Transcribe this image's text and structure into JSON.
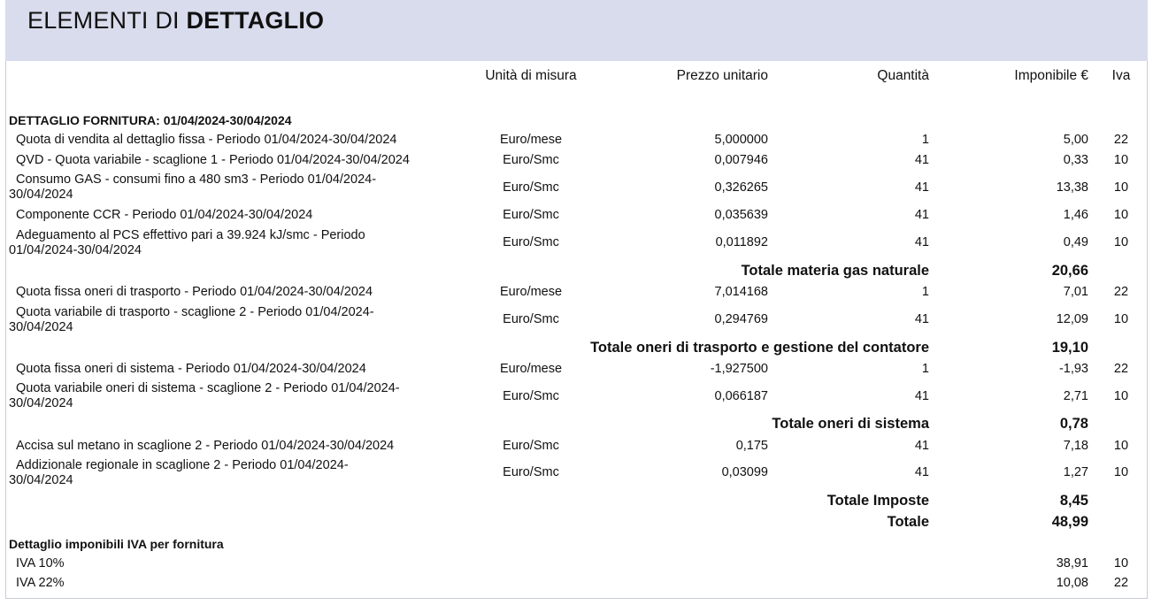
{
  "header": {
    "title_light": "ELEMENTI DI ",
    "title_bold": "DETTAGLIO"
  },
  "columns": {
    "unit": "Unità di misura",
    "price": "Prezzo unitario",
    "qty": "Quantità",
    "taxable": "Imponibile €",
    "vat": "Iva"
  },
  "section1_title": "DETTAGLIO FORNITURA: 01/04/2024-30/04/2024",
  "rows": [
    {
      "desc": "Quota di vendita al dettaglio fissa - Periodo 01/04/2024-30/04/2024",
      "unit": "Euro/mese",
      "price": "5,000000",
      "qty": "1",
      "taxable": "5,00",
      "vat": "22"
    },
    {
      "desc": "QVD - Quota variabile - scaglione 1 - Periodo 01/04/2024-30/04/2024",
      "unit": "Euro/Smc",
      "price": "0,007946",
      "qty": "41",
      "taxable": "0,33",
      "vat": "10"
    },
    {
      "desc_l1": "Consumo GAS - consumi fino a 480 sm3 - Periodo 01/04/2024-",
      "desc_l2": "30/04/2024",
      "unit": "Euro/Smc",
      "price": "0,326265",
      "qty": "41",
      "taxable": "13,38",
      "vat": "10"
    },
    {
      "desc": "Componente CCR - Periodo 01/04/2024-30/04/2024",
      "unit": "Euro/Smc",
      "price": "0,035639",
      "qty": "41",
      "taxable": "1,46",
      "vat": "10"
    },
    {
      "desc_l1": "Adeguamento al PCS effettivo pari a 39.924 kJ/smc - Periodo",
      "desc_l2": "01/04/2024-30/04/2024",
      "unit": "Euro/Smc",
      "price": "0,011892",
      "qty": "41",
      "taxable": "0,49",
      "vat": "10"
    },
    {
      "desc": "Quota fissa oneri di trasporto - Periodo 01/04/2024-30/04/2024",
      "unit": "Euro/mese",
      "price": "7,014168",
      "qty": "1",
      "taxable": "7,01",
      "vat": "22"
    },
    {
      "desc_l1": "Quota variabile di trasporto - scaglione 2 - Periodo 01/04/2024-",
      "desc_l2": "30/04/2024",
      "unit": "Euro/Smc",
      "price": "0,294769",
      "qty": "41",
      "taxable": "12,09",
      "vat": "10"
    },
    {
      "desc": "Quota fissa oneri di sistema - Periodo 01/04/2024-30/04/2024",
      "unit": "Euro/mese",
      "price": "-1,927500",
      "qty": "1",
      "taxable": "-1,93",
      "vat": "22"
    },
    {
      "desc_l1": "Quota variabile oneri di sistema - scaglione 2 - Periodo 01/04/2024-",
      "desc_l2": "30/04/2024",
      "unit": "Euro/Smc",
      "price": "0,066187",
      "qty": "41",
      "taxable": "2,71",
      "vat": "10"
    },
    {
      "desc": "Accisa sul metano in scaglione 2 - Periodo 01/04/2024-30/04/2024",
      "unit": "Euro/Smc",
      "price": "0,175",
      "qty": "41",
      "taxable": "7,18",
      "vat": "10"
    },
    {
      "desc_l1": "Addizionale regionale in scaglione 2 - Periodo 01/04/2024-",
      "desc_l2": "30/04/2024",
      "unit": "Euro/Smc",
      "price": "0,03099",
      "qty": "41",
      "taxable": "1,27",
      "vat": "10"
    }
  ],
  "subtotals": [
    {
      "label": "Totale materia gas naturale",
      "value": "20,66"
    },
    {
      "label": "Totale oneri di trasporto e gestione del contatore",
      "value": "19,10"
    },
    {
      "label": "Totale oneri di sistema",
      "value": "0,78"
    },
    {
      "label": "Totale Imposte",
      "value": "8,45"
    },
    {
      "label": "Totale",
      "value": "48,99"
    }
  ],
  "section2_title": "Dettaglio imponibili IVA per fornitura",
  "vat_rows": [
    {
      "label": "IVA 10%",
      "taxable": "38,91",
      "vat": "10"
    },
    {
      "label": "IVA 22%",
      "taxable": "10,08",
      "vat": "22"
    }
  ]
}
